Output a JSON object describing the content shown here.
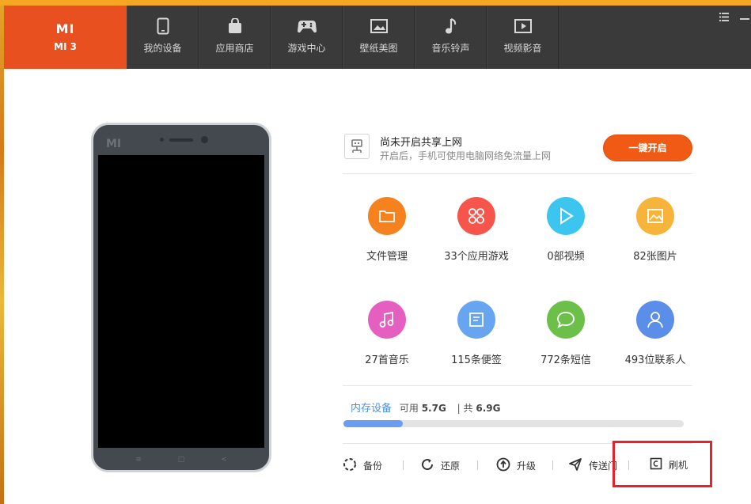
{
  "brand": {
    "logo": "MI",
    "model": "MI 3",
    "color": "#e8511f"
  },
  "nav": [
    {
      "label": "我的设备",
      "icon": "phone-icon"
    },
    {
      "label": "应用商店",
      "icon": "bag-icon"
    },
    {
      "label": "游戏中心",
      "icon": "gamepad-icon"
    },
    {
      "label": "壁纸美图",
      "icon": "picture-icon"
    },
    {
      "label": "音乐铃声",
      "icon": "music-note-icon"
    },
    {
      "label": "视频影音",
      "icon": "video-icon"
    }
  ],
  "window": {
    "menu_icon": "list-menu-icon",
    "minimize_icon": "minimize-icon"
  },
  "phone": {
    "logo": "MI"
  },
  "share": {
    "title": "尚未开启共享上网",
    "subtitle": "开启后，手机可使用电脑网络免流量上网",
    "button": "一键开启",
    "icon": "network-share-icon"
  },
  "grid": [
    {
      "label": "文件管理",
      "icon": "folder-icon",
      "color": "#f5821f"
    },
    {
      "label": "33个应用游戏",
      "icon": "apps-icon",
      "color": "#f5554a"
    },
    {
      "label": "0部视频",
      "icon": "play-icon",
      "color": "#3cc6ef"
    },
    {
      "label": "82张图片",
      "icon": "image-icon",
      "color": "#f7b43a"
    },
    {
      "label": "27首音乐",
      "icon": "music-icon",
      "color": "#e45fbf"
    },
    {
      "label": "115条便签",
      "icon": "note-icon",
      "color": "#67a5f0"
    },
    {
      "label": "772条短信",
      "icon": "message-icon",
      "color": "#6cc04a"
    },
    {
      "label": "493位联系人",
      "icon": "contact-icon",
      "color": "#5a8ee8"
    }
  ],
  "storage": {
    "label": "内存设备",
    "avail_label": "可用",
    "avail": "5.7G",
    "total_label": "共",
    "total": "6.9G",
    "used_fraction": 0.175
  },
  "actions": [
    {
      "label": "备份",
      "icon": "backup-icon"
    },
    {
      "label": "还原",
      "icon": "restore-icon"
    },
    {
      "label": "升级",
      "icon": "upgrade-icon"
    },
    {
      "label": "传送门",
      "icon": "send-icon"
    },
    {
      "label": "刷机",
      "icon": "flash-icon"
    }
  ]
}
